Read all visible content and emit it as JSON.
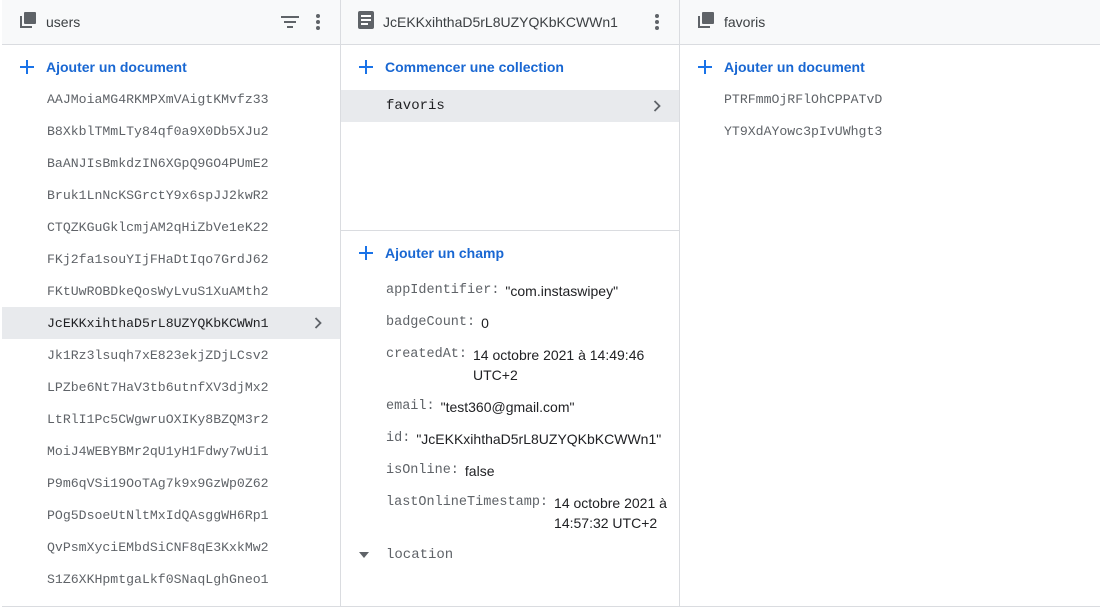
{
  "panel1": {
    "title": "users",
    "add_label": "Ajouter un document",
    "documents": [
      "AAJMoiaMG4RKMPXmVAigtKMvfz33",
      "B8XkblTMmLTy84qf0a9X0Db5XJu2",
      "BaANJIsBmkdzIN6XGpQ9GO4PUmE2",
      "Bruk1LnNcKSGrctY9x6spJJ2kwR2",
      "CTQZKGuGklcmjAM2qHiZbVe1eK22",
      "FKj2fa1souYIjFHaDtIqo7GrdJ62",
      "FKtUwROBDkeQosWyLvuS1XuAMth2",
      "JcEKKxihthaD5rL8UZYQKbKCWWn1",
      "Jk1Rz3lsuqh7xE823ekjZDjLCsv2",
      "LPZbe6Nt7HaV3tb6utnfXV3djMx2",
      "LtRlI1Pc5CWgwruOXIKy8BZQM3r2",
      "MoiJ4WEBYBMr2qU1yH1Fdwy7wUi1",
      "P9m6qVSi19OoTAg7k9x9GzWp0Z62",
      "POg5DsoeUtNltMxIdQAsggWH6Rp1",
      "QvPsmXyciEMbdSiCNF8qE3KxkMw2",
      "S1Z6XKHpmtgaLkf0SNaqLghGneo1"
    ],
    "selected_index": 7
  },
  "panel2": {
    "title": "JcEKKxihthaD5rL8UZYQKbKCWWn1",
    "add_collection_label": "Commencer une collection",
    "collections": [
      "favoris"
    ],
    "add_field_label": "Ajouter un champ",
    "fields": [
      {
        "key": "appIdentifier:",
        "value": "\"com.instaswipey\""
      },
      {
        "key": "badgeCount:",
        "value": "0"
      },
      {
        "key": "createdAt:",
        "value": "14 octobre 2021 à 14:49:46 UTC+2"
      },
      {
        "key": "email:",
        "value": "\"test360@gmail.com\""
      },
      {
        "key": "id:",
        "value": "\"JcEKKxihthaD5rL8UZYQKbKCWWn1\""
      },
      {
        "key": "isOnline:",
        "value": "false"
      },
      {
        "key": "lastOnlineTimestamp:",
        "value": "14 octobre 2021 à 14:57:32 UTC+2"
      }
    ],
    "location_label": "location"
  },
  "panel3": {
    "title": "favoris",
    "add_label": "Ajouter un document",
    "documents": [
      "PTRFmmOjRFlOhCPPATvD",
      "YT9XdAYowc3pIvUWhgt3"
    ]
  },
  "colors": {
    "accent": "#1a73e8",
    "selected_bg": "#e8eaed",
    "header_bg": "#f8f9fa",
    "border": "#dadce0"
  },
  "icons": {
    "collection": "collection-icon",
    "document": "document-icon",
    "filter": "filter-icon",
    "more": "more-vert-icon",
    "add": "plus-icon",
    "chevron": "chevron-right-icon"
  }
}
